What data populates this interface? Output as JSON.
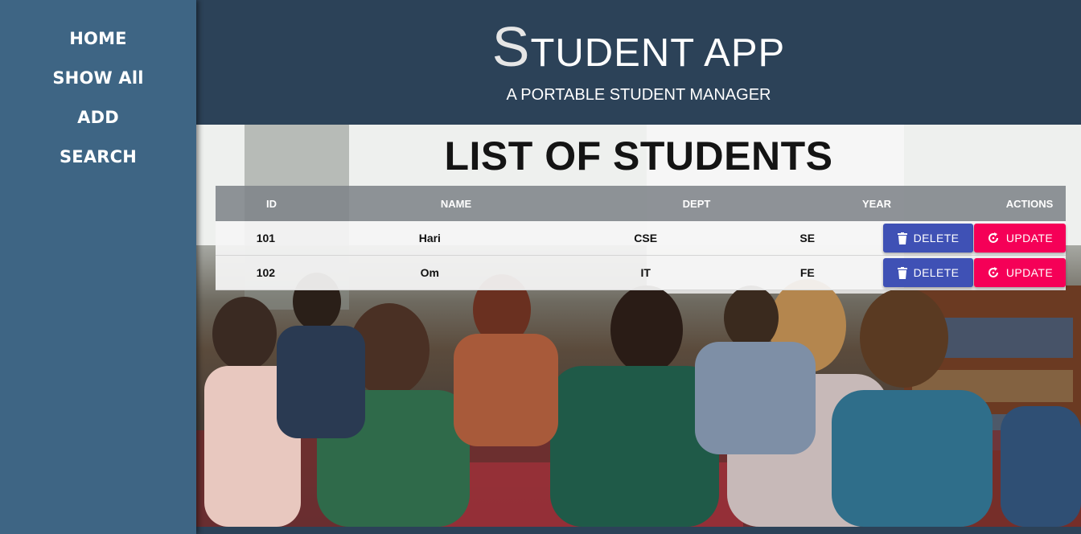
{
  "sidebar": {
    "items": [
      {
        "label": "HOME"
      },
      {
        "label": "SHOW All"
      },
      {
        "label": "ADD"
      },
      {
        "label": "SEARCH"
      }
    ]
  },
  "header": {
    "title_initial": "S",
    "title_rest": "tudent app",
    "subtitle": "A PORTABLE STUDENT MANAGER"
  },
  "main": {
    "heading": "LIST OF STUDENTS",
    "table": {
      "columns": [
        "ID",
        "NAME",
        "DEPT",
        "YEAR",
        "ACTIONS"
      ],
      "rows": [
        {
          "id": "101",
          "name": "Hari",
          "dept": "CSE",
          "year": "SE"
        },
        {
          "id": "102",
          "name": "Om",
          "dept": "IT",
          "year": "FE"
        }
      ],
      "delete_label": "DELETE",
      "update_label": "UPDATE"
    }
  },
  "colors": {
    "sidebar": "#3e6584",
    "header": "#2c4258",
    "delete_button": "#3f51b5",
    "update_button": "#f50057"
  },
  "icons": {
    "delete": "trash-icon",
    "update": "refresh-icon"
  }
}
